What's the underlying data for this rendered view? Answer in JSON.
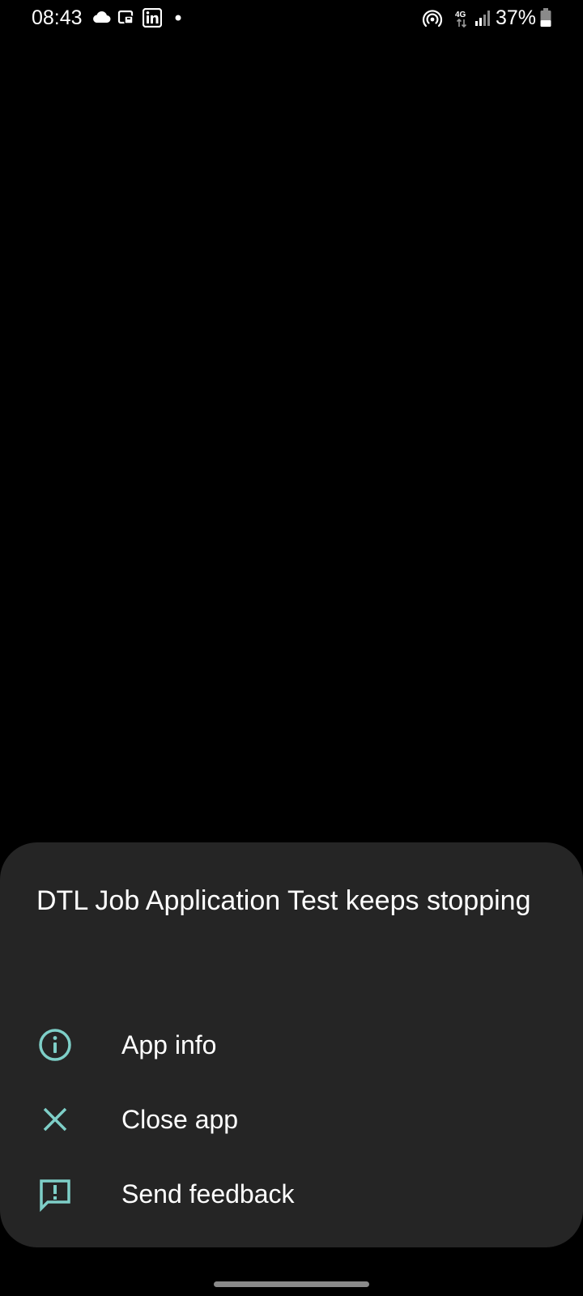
{
  "status_bar": {
    "time": "08:43",
    "battery_percent": "37%",
    "network_type": "4G",
    "left_icons": [
      "cloud-icon",
      "cast-icon",
      "linkedin-icon",
      "dot-icon"
    ],
    "right_icons": [
      "hotspot-icon",
      "data-arrows-icon",
      "signal-icon",
      "battery-icon"
    ]
  },
  "dialog": {
    "title": "DTL Job Application Test keeps stopping",
    "options": [
      {
        "label": "App info",
        "icon": "info-icon"
      },
      {
        "label": "Close app",
        "icon": "close-icon"
      },
      {
        "label": "Send feedback",
        "icon": "feedback-icon"
      }
    ]
  },
  "colors": {
    "background": "#000000",
    "sheet": "#252525",
    "accent": "#7ecfc8",
    "text": "#ffffff",
    "nav_handle": "#8a8a8a"
  }
}
